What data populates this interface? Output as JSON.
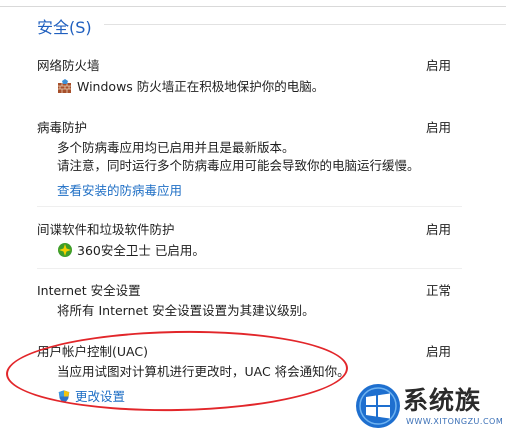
{
  "section": {
    "title": "安全(S)"
  },
  "items": [
    {
      "label": "网络防火墙",
      "status": "启用",
      "desc": [
        "Windows 防火墙正在积极地保护你的电脑。"
      ],
      "icon": "firewall-icon"
    },
    {
      "label": "病毒防护",
      "status": "启用",
      "desc": [
        "多个防病毒应用均已启用并且是最新版本。",
        "请注意，同时运行多个防病毒应用可能会导致你的电脑运行缓慢。"
      ],
      "link": "查看安装的防病毒应用"
    },
    {
      "label": "间谍软件和垃圾软件防护",
      "status": "启用",
      "desc": [
        "360安全卫士 已启用。"
      ],
      "icon": "360-safe-icon"
    },
    {
      "label": "Internet 安全设置",
      "status": "正常",
      "desc": [
        "将所有 Internet 安全设置设置为其建议级别。"
      ]
    },
    {
      "label": "用户帐户控制(UAC)",
      "status": "启用",
      "desc": [
        "当应用试图对计算机进行更改时，UAC 将会通知你。"
      ],
      "link": "更改设置",
      "icon": "uac-shield-icon"
    }
  ],
  "watermark": {
    "name": "系统族",
    "url": "WWW.XITONGZU.COM"
  },
  "colors": {
    "accent": "#1f5fbf",
    "link": "#1f6fc5",
    "annotation": "#e2262a"
  }
}
